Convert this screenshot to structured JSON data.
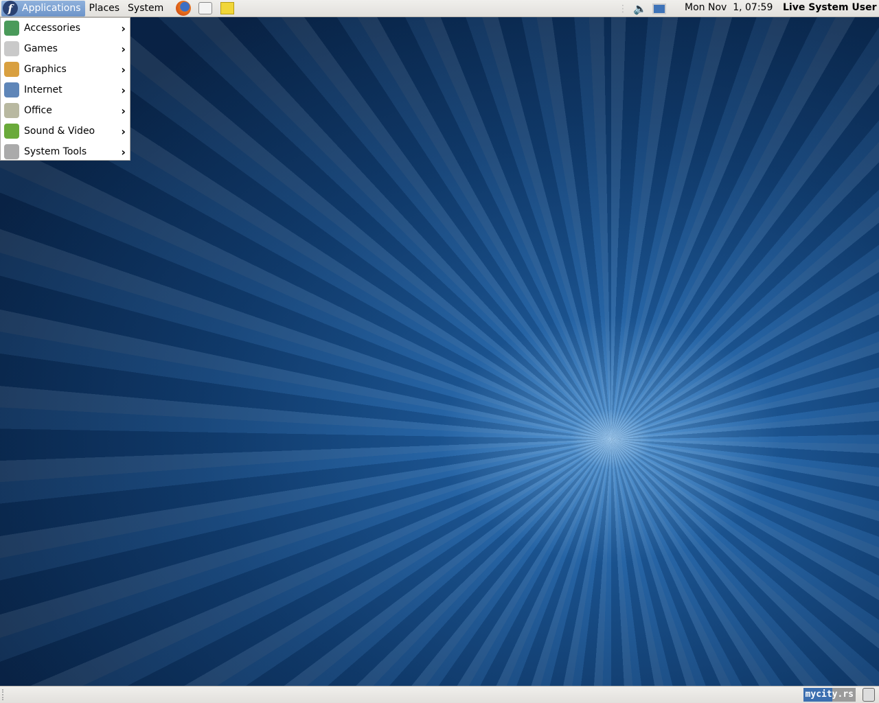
{
  "top_panel": {
    "menus": [
      {
        "label": "Applications"
      },
      {
        "label": "Places"
      },
      {
        "label": "System"
      }
    ],
    "launchers": [
      "firefox-icon",
      "evolution-mail-icon",
      "notes-icon"
    ],
    "tray": [
      "volume-icon",
      "network-icon"
    ],
    "clock": "Mon Nov  1, 07:59",
    "user": "Live System User"
  },
  "applications_menu": {
    "items": [
      {
        "label": "Accessories",
        "icon": "accessories-icon",
        "color": "#4a9a5a"
      },
      {
        "label": "Games",
        "icon": "games-icon",
        "color": "#c9c9c9"
      },
      {
        "label": "Graphics",
        "icon": "graphics-icon",
        "color": "#d9a040"
      },
      {
        "label": "Internet",
        "icon": "internet-icon",
        "color": "#5f86b8"
      },
      {
        "label": "Office",
        "icon": "office-icon",
        "color": "#b8b8a0"
      },
      {
        "label": "Sound & Video",
        "icon": "sound-video-icon",
        "color": "#6aaa3a"
      },
      {
        "label": "System Tools",
        "icon": "system-tools-icon",
        "color": "#aaaaaa"
      }
    ]
  },
  "bottom_panel": {
    "watermark": "mycity.rs",
    "trash": "trash-icon"
  }
}
